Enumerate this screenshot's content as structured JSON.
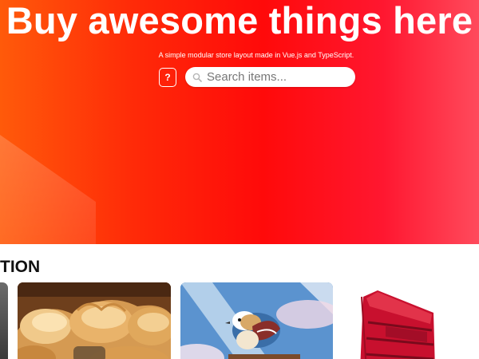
{
  "hero": {
    "title": "Buy awesome things here",
    "subtitle": "A simple modular store layout made in Vue.js and TypeScript.",
    "help_label": "?",
    "search": {
      "placeholder": "Search items...",
      "value": "",
      "icon": "search-icon"
    }
  },
  "section": {
    "heading": "TION"
  },
  "products": [
    {
      "image": "partial-product-image"
    },
    {
      "image": "bread-pastries-image"
    },
    {
      "image": "bird-illustration-image"
    },
    {
      "image": "cake-slice-image"
    }
  ],
  "colors": {
    "hero_gradient_start": "#ff5a0a",
    "hero_gradient_mid": "#ff0a0a",
    "hero_gradient_end": "#ff4a5c",
    "text_light": "#ffffff",
    "heading": "#111111"
  }
}
